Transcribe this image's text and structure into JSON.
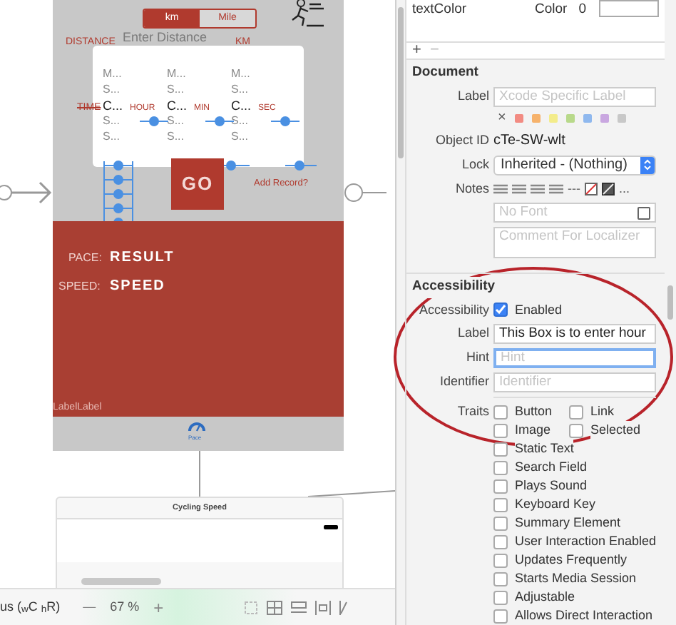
{
  "canvas": {
    "scene_main": {
      "segment": [
        {
          "label": "km",
          "selected": true
        },
        {
          "label": "Mile",
          "selected": false
        }
      ],
      "distance_label": "DISTANCE",
      "distance_placeholder": "Enter Distance",
      "distance_unit": "KM",
      "time_label": "TIME",
      "pickers": [
        {
          "rows": [
            "M...",
            "S...",
            "C...",
            "S...",
            "S..."
          ],
          "unit": "HOUR"
        },
        {
          "rows": [
            "M...",
            "S...",
            "C...",
            "S...",
            "S..."
          ],
          "unit": "MIN"
        },
        {
          "rows": [
            "M...",
            "S...",
            "C...",
            "S...",
            "S..."
          ],
          "unit": "SEC"
        }
      ],
      "go_button": "GO",
      "add_record": "Add Record?",
      "pace_label": "PACE:",
      "pace_value": "RESULT",
      "speed_label": "SPEED:",
      "speed_value": "SPEED",
      "footer_label": "LabelLabel",
      "tab": {
        "label": "Pace",
        "selected": true
      }
    },
    "scene_second": {
      "title": "Cycling Speed"
    }
  },
  "toolbar": {
    "device": "us ($_{w}$C $_{h}$R)",
    "zoom_out": "—",
    "zoom": "67 %",
    "zoom_in": "+"
  },
  "inspector": {
    "top_row": {
      "name": "textColor",
      "type": "Color",
      "value": "0"
    },
    "add": "+",
    "remove": "−",
    "document": {
      "title": "Document",
      "label_label": "Label",
      "label_placeholder": "Xcode Specific Label",
      "clear": "×",
      "colors": [
        {
          "color": "#f28b82"
        },
        {
          "color": "#f6b26b"
        },
        {
          "color": "#f3ec8a"
        },
        {
          "color": "#b8d98a"
        },
        {
          "color": "#8fb8ee"
        },
        {
          "color": "#c9a7e0"
        },
        {
          "color": "#c8c8c8"
        }
      ],
      "object_id_label": "Object ID",
      "object_id": "cTe-SW-wlt",
      "lock_label": "Lock",
      "lock_value": "Inherited - (Nothing)",
      "notes_label": "Notes",
      "notes_dashes": "---",
      "notes_more": "...",
      "font_placeholder": "No Font",
      "comment_placeholder": "Comment For Localizer"
    },
    "accessibility": {
      "title": "Accessibility",
      "accessibility_label": "Accessibility",
      "enabled": {
        "label": "Enabled",
        "checked": true
      },
      "label_label": "Label",
      "label_value": "This Box is to enter hour",
      "hint_label": "Hint",
      "hint_placeholder": "Hint",
      "identifier_label": "Identifier",
      "identifier_placeholder": "Identifier",
      "traits_label": "Traits",
      "traits": [
        {
          "label": "Button",
          "checked": false
        },
        {
          "label": "Link",
          "checked": false
        },
        {
          "label": "Image",
          "checked": false
        },
        {
          "label": "Selected",
          "checked": false
        },
        {
          "label": "Static Text",
          "checked": false
        },
        {
          "label": "Search Field",
          "checked": false
        },
        {
          "label": "Plays Sound",
          "checked": false
        },
        {
          "label": "Keyboard Key",
          "checked": false
        },
        {
          "label": "Summary Element",
          "checked": false
        },
        {
          "label": "User Interaction Enabled",
          "checked": false
        },
        {
          "label": "Updates Frequently",
          "checked": false
        },
        {
          "label": "Starts Media Session",
          "checked": false
        },
        {
          "label": "Adjustable",
          "checked": false
        },
        {
          "label": "Allows Direct Interaction",
          "checked": false
        }
      ]
    }
  }
}
